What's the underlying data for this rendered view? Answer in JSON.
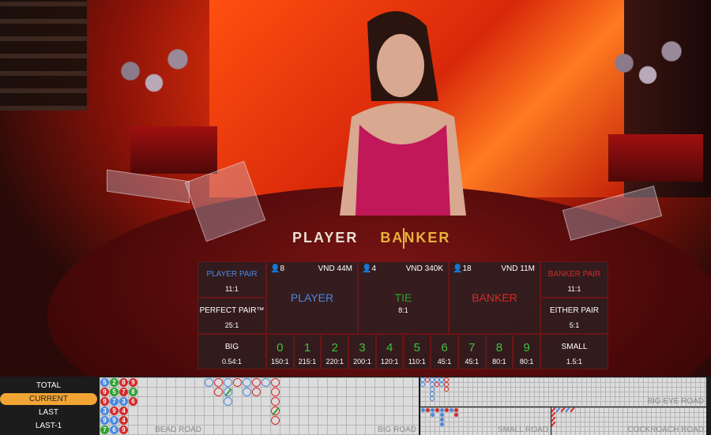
{
  "colors": {
    "player": "#4a88e0",
    "banker": "#d42a2a",
    "tie": "#2ea02e",
    "gold": "#e8b23a",
    "active": "#f2a534"
  },
  "table_label": {
    "player": "PLAYER",
    "banker": "BANKER"
  },
  "bets": {
    "player_pair": {
      "label": "PLAYER PAIR",
      "odds": "11:1"
    },
    "perfect_pair": {
      "label": "PERFECT PAIR™",
      "odds": "25:1"
    },
    "banker_pair": {
      "label": "BANKER PAIR",
      "odds": "11:1"
    },
    "either_pair": {
      "label": "EITHER PAIR",
      "odds": "5:1"
    },
    "player": {
      "label": "PLAYER",
      "players": "8",
      "amount": "VND 44M"
    },
    "tie": {
      "label": "TIE",
      "odds": "8:1",
      "players": "4",
      "amount": "VND 340K"
    },
    "banker": {
      "label": "BANKER",
      "players": "18",
      "amount": "VND 11M"
    },
    "big": {
      "label": "BIG",
      "odds": "0.54:1"
    },
    "small": {
      "label": "SMALL",
      "odds": "1.5:1"
    },
    "numbers": [
      {
        "n": "0",
        "o": "150:1"
      },
      {
        "n": "1",
        "o": "215:1"
      },
      {
        "n": "2",
        "o": "220:1"
      },
      {
        "n": "3",
        "o": "200:1"
      },
      {
        "n": "4",
        "o": "120:1"
      },
      {
        "n": "5",
        "o": "110:1"
      },
      {
        "n": "6",
        "o": "45:1"
      },
      {
        "n": "7",
        "o": "45:1"
      },
      {
        "n": "8",
        "o": "80:1"
      },
      {
        "n": "9",
        "o": "80:1"
      }
    ]
  },
  "stats_menu": {
    "items": [
      "TOTAL",
      "CURRENT",
      "LAST",
      "LAST-1"
    ],
    "active": "CURRENT"
  },
  "roads": {
    "bead_road": {
      "label": "BEAD ROAD",
      "columns": [
        [
          [
            "5",
            "P"
          ],
          [
            "9",
            "B"
          ],
          [
            "9",
            "B"
          ],
          [
            "3",
            "P"
          ],
          [
            "9",
            "P"
          ],
          [
            "7",
            "T"
          ]
        ],
        [
          [
            "2",
            "T"
          ],
          [
            "5",
            "T"
          ],
          [
            "7",
            "P"
          ],
          [
            "9",
            "B"
          ],
          [
            "9",
            "P"
          ],
          [
            "6",
            "P"
          ]
        ],
        [
          [
            "8",
            "B"
          ],
          [
            "7",
            "B"
          ],
          [
            "3",
            "P"
          ],
          [
            "4",
            "B"
          ],
          [
            "4",
            "B"
          ],
          [
            "9",
            "B"
          ]
        ],
        [
          [
            "9",
            "B"
          ],
          [
            "8",
            "T"
          ],
          [
            "6",
            "B"
          ]
        ]
      ]
    },
    "big_road": {
      "label": "BIG ROAD",
      "columns": [
        [
          "P"
        ],
        [
          "B",
          "B"
        ],
        [
          "P",
          "P*",
          "P"
        ],
        [
          "B"
        ],
        [
          "P",
          "P"
        ],
        [
          "B",
          "B"
        ],
        [
          "P"
        ],
        [
          "B",
          "B",
          "B",
          "B*",
          "B"
        ]
      ]
    },
    "big_eye_road": {
      "label": "BIG EYE ROAD",
      "columns": [
        [
          "P",
          "P"
        ],
        [
          "B"
        ],
        [
          "P",
          "P",
          "P",
          "P",
          "P"
        ],
        [
          "P",
          "B"
        ],
        [
          "P",
          "P"
        ],
        [
          "B",
          "B",
          "B"
        ]
      ]
    },
    "small_road": {
      "label": "SMALL ROAD",
      "columns": [
        [
          "P"
        ],
        [
          "B"
        ],
        [
          "P",
          "P"
        ],
        [
          "B"
        ],
        [
          "P",
          "P",
          "P",
          "P"
        ],
        [
          "B"
        ],
        [
          "P"
        ],
        [
          "B",
          "B"
        ]
      ]
    },
    "cockroach_road": {
      "label": "COCKROACH ROAD",
      "columns": [
        [
          "B",
          "B",
          "B",
          "B"
        ],
        [
          "P"
        ],
        [
          "B"
        ],
        [
          "P"
        ],
        [
          "B"
        ]
      ]
    }
  }
}
